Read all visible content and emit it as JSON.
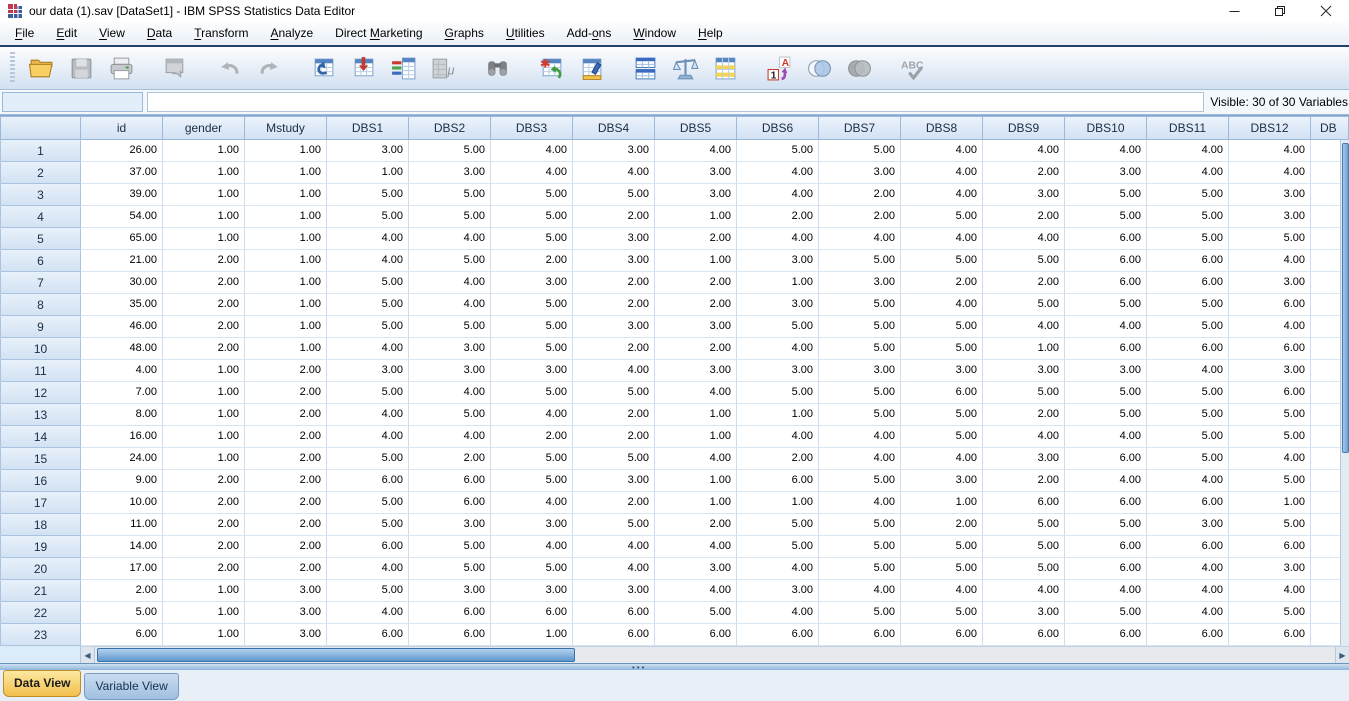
{
  "window": {
    "title": "our data (1).sav [DataSet1] - IBM SPSS Statistics Data Editor",
    "controls": {
      "minimize": "minimize",
      "restore": "restore",
      "close": "close"
    }
  },
  "menu_bar": {
    "items": [
      {
        "label": "File",
        "mnemonic": "F"
      },
      {
        "label": "Edit",
        "mnemonic": "E"
      },
      {
        "label": "View",
        "mnemonic": "V"
      },
      {
        "label": "Data",
        "mnemonic": "D"
      },
      {
        "label": "Transform",
        "mnemonic": "T"
      },
      {
        "label": "Analyze",
        "mnemonic": "A"
      },
      {
        "label": "Direct Marketing",
        "mnemonic": "M"
      },
      {
        "label": "Graphs",
        "mnemonic": "G"
      },
      {
        "label": "Utilities",
        "mnemonic": "U"
      },
      {
        "label": "Add-ons",
        "mnemonic": "o"
      },
      {
        "label": "Window",
        "mnemonic": "W"
      },
      {
        "label": "Help",
        "mnemonic": "H"
      }
    ]
  },
  "toolbar": {
    "buttons": [
      {
        "name": "open-file",
        "enabled": true,
        "group_start": false
      },
      {
        "name": "save",
        "enabled": false,
        "group_start": false
      },
      {
        "name": "print",
        "enabled": true,
        "group_start": false
      },
      {
        "name": "recall-dialogs",
        "enabled": false,
        "group_start": true
      },
      {
        "name": "undo",
        "enabled": false,
        "group_start": true
      },
      {
        "name": "redo",
        "enabled": false,
        "group_start": false
      },
      {
        "name": "goto-case",
        "enabled": true,
        "group_start": true
      },
      {
        "name": "goto-variable",
        "enabled": true,
        "group_start": false
      },
      {
        "name": "variables",
        "enabled": true,
        "group_start": false
      },
      {
        "name": "descriptives",
        "enabled": false,
        "group_start": false
      },
      {
        "name": "find",
        "enabled": true,
        "group_start": true
      },
      {
        "name": "insert-cases",
        "enabled": true,
        "group_start": true
      },
      {
        "name": "insert-variable",
        "enabled": true,
        "group_start": false
      },
      {
        "name": "split-file",
        "enabled": true,
        "group_start": true
      },
      {
        "name": "weight-cases",
        "enabled": true,
        "group_start": false
      },
      {
        "name": "select-cases",
        "enabled": true,
        "group_start": false
      },
      {
        "name": "value-labels",
        "enabled": true,
        "group_start": true
      },
      {
        "name": "use-variable-sets",
        "enabled": true,
        "group_start": false
      },
      {
        "name": "show-all-variables",
        "enabled": false,
        "group_start": false
      },
      {
        "name": "spell-check",
        "enabled": false,
        "group_start": true
      }
    ]
  },
  "formula_bar": {
    "cell_indicator_value": "",
    "editor_value": "",
    "visible_label": "Visible: 30 of 30 Variables"
  },
  "grid": {
    "columns": [
      "id",
      "gender",
      "Mstudy",
      "DBS1",
      "DBS2",
      "DBS3",
      "DBS4",
      "DBS5",
      "DBS6",
      "DBS7",
      "DBS8",
      "DBS9",
      "DBS10",
      "DBS11",
      "DBS12"
    ],
    "partial_column_label": "DB",
    "rows": [
      {
        "n": "1",
        "cells": [
          "26.00",
          "1.00",
          "1.00",
          "3.00",
          "5.00",
          "4.00",
          "3.00",
          "4.00",
          "5.00",
          "5.00",
          "4.00",
          "4.00",
          "4.00",
          "4.00",
          "4.00"
        ]
      },
      {
        "n": "2",
        "cells": [
          "37.00",
          "1.00",
          "1.00",
          "1.00",
          "3.00",
          "4.00",
          "4.00",
          "3.00",
          "4.00",
          "3.00",
          "4.00",
          "2.00",
          "3.00",
          "4.00",
          "4.00"
        ]
      },
      {
        "n": "3",
        "cells": [
          "39.00",
          "1.00",
          "1.00",
          "5.00",
          "5.00",
          "5.00",
          "5.00",
          "3.00",
          "4.00",
          "2.00",
          "4.00",
          "3.00",
          "5.00",
          "5.00",
          "3.00"
        ]
      },
      {
        "n": "4",
        "cells": [
          "54.00",
          "1.00",
          "1.00",
          "5.00",
          "5.00",
          "5.00",
          "2.00",
          "1.00",
          "2.00",
          "2.00",
          "5.00",
          "2.00",
          "5.00",
          "5.00",
          "3.00"
        ]
      },
      {
        "n": "5",
        "cells": [
          "65.00",
          "1.00",
          "1.00",
          "4.00",
          "4.00",
          "5.00",
          "3.00",
          "2.00",
          "4.00",
          "4.00",
          "4.00",
          "4.00",
          "6.00",
          "5.00",
          "5.00"
        ]
      },
      {
        "n": "6",
        "cells": [
          "21.00",
          "2.00",
          "1.00",
          "4.00",
          "5.00",
          "2.00",
          "3.00",
          "1.00",
          "3.00",
          "5.00",
          "5.00",
          "5.00",
          "6.00",
          "6.00",
          "4.00"
        ]
      },
      {
        "n": "7",
        "cells": [
          "30.00",
          "2.00",
          "1.00",
          "5.00",
          "4.00",
          "3.00",
          "2.00",
          "2.00",
          "1.00",
          "3.00",
          "2.00",
          "2.00",
          "6.00",
          "6.00",
          "3.00"
        ]
      },
      {
        "n": "8",
        "cells": [
          "35.00",
          "2.00",
          "1.00",
          "5.00",
          "4.00",
          "5.00",
          "2.00",
          "2.00",
          "3.00",
          "5.00",
          "4.00",
          "5.00",
          "5.00",
          "5.00",
          "6.00"
        ]
      },
      {
        "n": "9",
        "cells": [
          "46.00",
          "2.00",
          "1.00",
          "5.00",
          "5.00",
          "5.00",
          "3.00",
          "3.00",
          "5.00",
          "5.00",
          "5.00",
          "4.00",
          "4.00",
          "5.00",
          "4.00"
        ]
      },
      {
        "n": "10",
        "cells": [
          "48.00",
          "2.00",
          "1.00",
          "4.00",
          "3.00",
          "5.00",
          "2.00",
          "2.00",
          "4.00",
          "5.00",
          "5.00",
          "1.00",
          "6.00",
          "6.00",
          "6.00"
        ]
      },
      {
        "n": "11",
        "cells": [
          "4.00",
          "1.00",
          "2.00",
          "3.00",
          "3.00",
          "3.00",
          "4.00",
          "3.00",
          "3.00",
          "3.00",
          "3.00",
          "3.00",
          "3.00",
          "4.00",
          "3.00"
        ]
      },
      {
        "n": "12",
        "cells": [
          "7.00",
          "1.00",
          "2.00",
          "5.00",
          "4.00",
          "5.00",
          "5.00",
          "4.00",
          "5.00",
          "5.00",
          "6.00",
          "5.00",
          "5.00",
          "5.00",
          "6.00"
        ]
      },
      {
        "n": "13",
        "cells": [
          "8.00",
          "1.00",
          "2.00",
          "4.00",
          "5.00",
          "4.00",
          "2.00",
          "1.00",
          "1.00",
          "5.00",
          "5.00",
          "2.00",
          "5.00",
          "5.00",
          "5.00"
        ]
      },
      {
        "n": "14",
        "cells": [
          "16.00",
          "1.00",
          "2.00",
          "4.00",
          "4.00",
          "2.00",
          "2.00",
          "1.00",
          "4.00",
          "4.00",
          "5.00",
          "4.00",
          "4.00",
          "5.00",
          "5.00"
        ]
      },
      {
        "n": "15",
        "cells": [
          "24.00",
          "1.00",
          "2.00",
          "5.00",
          "2.00",
          "5.00",
          "5.00",
          "4.00",
          "2.00",
          "4.00",
          "4.00",
          "3.00",
          "6.00",
          "5.00",
          "4.00"
        ]
      },
      {
        "n": "16",
        "cells": [
          "9.00",
          "2.00",
          "2.00",
          "6.00",
          "6.00",
          "5.00",
          "3.00",
          "1.00",
          "6.00",
          "5.00",
          "3.00",
          "2.00",
          "4.00",
          "4.00",
          "5.00"
        ]
      },
      {
        "n": "17",
        "cells": [
          "10.00",
          "2.00",
          "2.00",
          "5.00",
          "6.00",
          "4.00",
          "2.00",
          "1.00",
          "1.00",
          "4.00",
          "1.00",
          "6.00",
          "6.00",
          "6.00",
          "1.00"
        ]
      },
      {
        "n": "18",
        "cells": [
          "11.00",
          "2.00",
          "2.00",
          "5.00",
          "3.00",
          "3.00",
          "5.00",
          "2.00",
          "5.00",
          "5.00",
          "2.00",
          "5.00",
          "5.00",
          "3.00",
          "5.00"
        ]
      },
      {
        "n": "19",
        "cells": [
          "14.00",
          "2.00",
          "2.00",
          "6.00",
          "5.00",
          "4.00",
          "4.00",
          "4.00",
          "5.00",
          "5.00",
          "5.00",
          "5.00",
          "6.00",
          "6.00",
          "6.00"
        ]
      },
      {
        "n": "20",
        "cells": [
          "17.00",
          "2.00",
          "2.00",
          "4.00",
          "5.00",
          "5.00",
          "4.00",
          "3.00",
          "4.00",
          "5.00",
          "5.00",
          "5.00",
          "6.00",
          "4.00",
          "3.00"
        ]
      },
      {
        "n": "21",
        "cells": [
          "2.00",
          "1.00",
          "3.00",
          "5.00",
          "3.00",
          "3.00",
          "3.00",
          "4.00",
          "3.00",
          "4.00",
          "4.00",
          "4.00",
          "4.00",
          "4.00",
          "4.00"
        ]
      },
      {
        "n": "22",
        "cells": [
          "5.00",
          "1.00",
          "3.00",
          "4.00",
          "6.00",
          "6.00",
          "6.00",
          "5.00",
          "4.00",
          "5.00",
          "5.00",
          "3.00",
          "5.00",
          "4.00",
          "5.00"
        ]
      },
      {
        "n": "23",
        "cells": [
          "6.00",
          "1.00",
          "3.00",
          "6.00",
          "6.00",
          "1.00",
          "6.00",
          "6.00",
          "6.00",
          "6.00",
          "6.00",
          "6.00",
          "6.00",
          "6.00",
          "6.00"
        ]
      }
    ]
  },
  "tabs": [
    {
      "label": "Data View",
      "active": true
    },
    {
      "label": "Variable View",
      "active": false
    }
  ]
}
